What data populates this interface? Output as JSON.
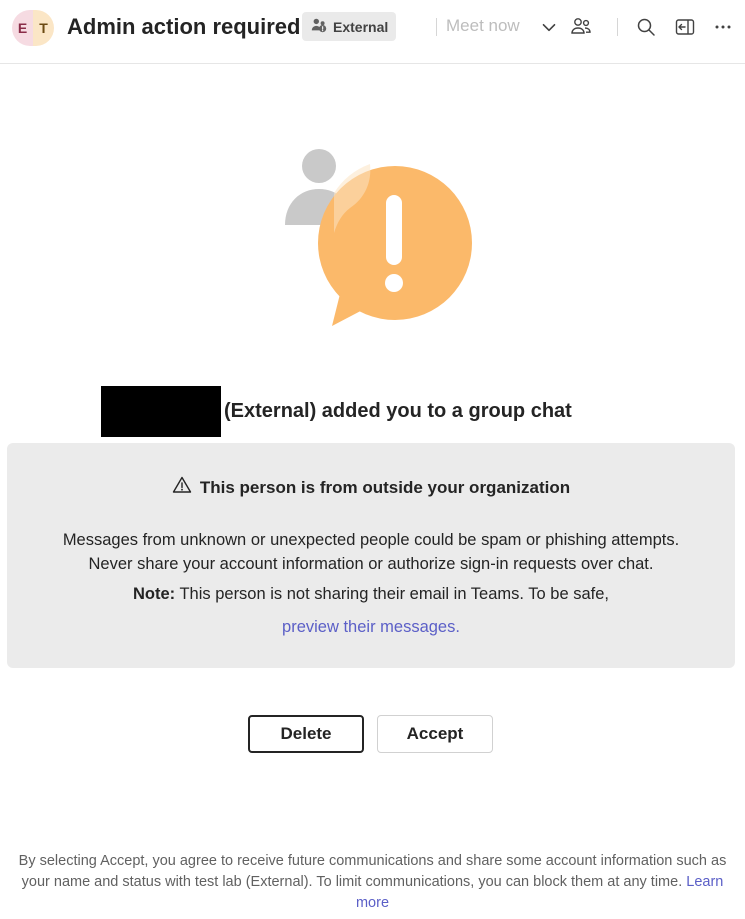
{
  "header": {
    "avatar_initials": [
      "E",
      "T"
    ],
    "title": "Admin action required",
    "badge": "External",
    "meet_now": "Meet now",
    "icons": [
      "people-icon",
      "chevron-down-icon",
      "participants-icon",
      "search-icon",
      "pop-out-icon",
      "more-icon"
    ]
  },
  "main": {
    "headline": "(External) added you to a group chat",
    "warning": {
      "title": "This person is from outside your organization",
      "line1": "Messages from unknown or unexpected people could be spam or phishing attempts.",
      "line2": "Never share your account information or authorize sign-in requests over chat.",
      "note_label": "Note:",
      "note_text": " This person is not sharing their email in Teams. To be safe,",
      "link": "preview their messages."
    },
    "buttons": {
      "delete": "Delete",
      "accept": "Accept"
    }
  },
  "footer": {
    "text": "By selecting Accept, you agree to receive future communications and share some account information such as your name and status with test lab (External). To limit communications, you can block them at any time.",
    "link": "Learn more"
  },
  "colors": {
    "accent": "#5b5fc7",
    "warning_orange": "#fbb96a",
    "panel_bg": "#ebebeb"
  }
}
